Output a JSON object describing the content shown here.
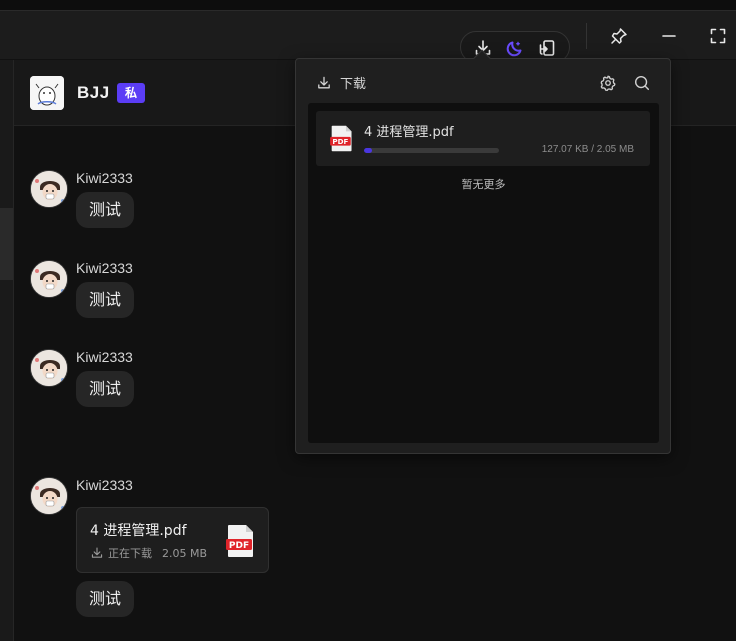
{
  "toolbar": {
    "icons": [
      "download-icon",
      "moon-icon",
      "screen-share-icon",
      "pin-icon",
      "minimize-icon",
      "fullscreen-icon"
    ],
    "accent_color": "#5b3df5"
  },
  "chat": {
    "title": "BJJ",
    "private_badge": "私"
  },
  "messages": [
    {
      "sender": "Kiwi2333",
      "text": "测试"
    },
    {
      "sender": "Kiwi2333",
      "text": "测试"
    },
    {
      "sender": "Kiwi2333",
      "text": "测试"
    },
    {
      "sender": "Kiwi2333",
      "file": {
        "name": "4 进程管理.pdf",
        "status": "正在下载",
        "size": "2.05 MB",
        "type_label": "PDF"
      },
      "text": "测试"
    }
  ],
  "download_panel": {
    "title": "下载",
    "items": [
      {
        "name": "4 进程管理.pdf",
        "progress": 0.06,
        "sizes": "127.07 KB / 2.05 MB",
        "type_label": "PDF"
      }
    ],
    "end_text": "暂无更多",
    "progress_color": "#4a36e0"
  }
}
